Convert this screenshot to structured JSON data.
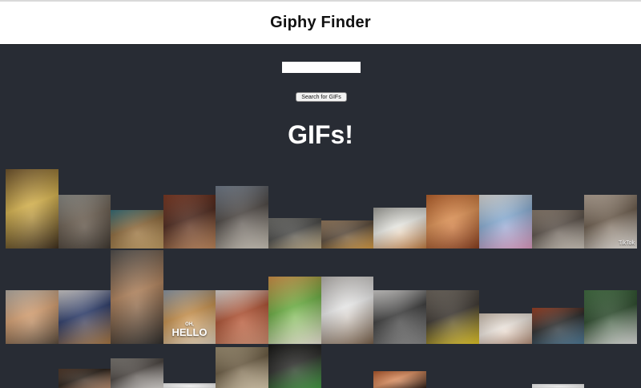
{
  "header": {
    "title": "Giphy Finder"
  },
  "search": {
    "value": "",
    "button_label": "Search for GIFs"
  },
  "results": {
    "title": "GIFs!",
    "gifs": [
      {
        "name": "gif-dogs-hard-hats",
        "colors": [
          "#7a5c32",
          "#3b2a17",
          "#d9b44a"
        ]
      },
      {
        "name": "gif-dog-standing",
        "colors": [
          "#9a9a94",
          "#3c342c",
          "#6b5e50"
        ]
      },
      {
        "name": "gif-three-goldens",
        "colors": [
          "#3d7a86",
          "#c9a262",
          "#8f6a3a"
        ]
      },
      {
        "name": "gif-dog-kitchen",
        "colors": [
          "#8a4028",
          "#c78a5a",
          "#4a2418"
        ]
      },
      {
        "name": "gif-man-playing-dog",
        "colors": [
          "#7e8a9a",
          "#d6cfc2",
          "#4a4440"
        ]
      },
      {
        "name": "gif-dog-yard",
        "colors": [
          "#7a7a76",
          "#c9b48a",
          "#4a4a48"
        ]
      },
      {
        "name": "gif-dog-lying",
        "colors": [
          "#a88a6a",
          "#e0a040",
          "#5a4a3a"
        ]
      },
      {
        "name": "gif-dachshund-run",
        "colors": [
          "#b0b0aa",
          "#c98040",
          "#f0f0ea"
        ]
      },
      {
        "name": "gif-puppy-hallway",
        "colors": [
          "#c76a30",
          "#8a3a18",
          "#e09050"
        ]
      },
      {
        "name": "gif-cartoon-bed",
        "colors": [
          "#f4f2ee",
          "#e8a0c8",
          "#8ab0d8"
        ]
      },
      {
        "name": "gif-dog-couch",
        "colors": [
          "#9a8a7a",
          "#d8d0c4",
          "#5a5048"
        ]
      },
      {
        "name": "gif-frenchie-mask",
        "colors": [
          "#c8b8a8",
          "#f0ece6",
          "#6a5a4a"
        ],
        "watermark": "TikTok"
      },
      {
        "name": "gif-pugs-basket",
        "colors": [
          "#c8c0b6",
          "#5a4a3a",
          "#d8a070"
        ]
      },
      {
        "name": "gif-dog-bed-sheets",
        "colors": [
          "#e8e4e2",
          "#b07a40",
          "#2a3a6a"
        ]
      },
      {
        "name": "gif-dogs-car-trunk",
        "colors": [
          "#5a5856",
          "#2a2826",
          "#b08058"
        ]
      },
      {
        "name": "gif-oh-hello-dog",
        "colors": [
          "#9aa8b8",
          "#e8d8c0",
          "#c8904a"
        ],
        "text_small": "OH,",
        "text_big": "HELLO"
      },
      {
        "name": "gif-hands-puppy",
        "colors": [
          "#f4f0ec",
          "#d89070",
          "#b05030"
        ]
      },
      {
        "name": "gif-puppies-treats",
        "colors": [
          "#e8a050",
          "#f8f0e0",
          "#6ab040"
        ]
      },
      {
        "name": "gif-dogs-snow",
        "colors": [
          "#c8c4c0",
          "#7a6048",
          "#f0f0f0"
        ]
      },
      {
        "name": "gif-husky-puppy",
        "colors": [
          "#e8e6e4",
          "#8a8a8a",
          "#3a3a3a"
        ]
      },
      {
        "name": "gif-dog-yellow-toy",
        "colors": [
          "#7a7268",
          "#f0d020",
          "#3a342e"
        ]
      },
      {
        "name": "gif-puppy-floor",
        "colors": [
          "#e0d0c0",
          "#b89078",
          "#f4ece4"
        ]
      },
      {
        "name": "gif-dog-rug",
        "colors": [
          "#b04a2a",
          "#4a7a9a",
          "#2a2a2a"
        ]
      },
      {
        "name": "gif-dog-bowl",
        "colors": [
          "#4a7a4a",
          "#e8e8e6",
          "#2a4a2a"
        ]
      },
      {
        "name": "gif-puppy-small",
        "colors": [
          "#5a4030",
          "#c09070",
          "#2a2018"
        ]
      },
      {
        "name": "gif-husky-door",
        "colors": [
          "#8a8680",
          "#e8e4e0",
          "#4a4440"
        ]
      },
      {
        "name": "gif-blank-white",
        "colors": [
          "#ffffff",
          "#f6f6f6",
          "#eeeeee"
        ]
      },
      {
        "name": "gif-puppy-pile",
        "colors": [
          "#b0a080",
          "#e8d8b8",
          "#6a5a40"
        ]
      },
      {
        "name": "gif-dog-dark",
        "colors": [
          "#1a1a18",
          "#40a040",
          "#2a2a28"
        ]
      },
      {
        "name": "gif-orange-room",
        "colors": [
          "#c06030",
          "#2a1810",
          "#e09060"
        ]
      },
      {
        "name": "gif-white-partial",
        "colors": [
          "#ffffff",
          "#f4f4f4",
          "#e8e8e8"
        ]
      }
    ]
  }
}
